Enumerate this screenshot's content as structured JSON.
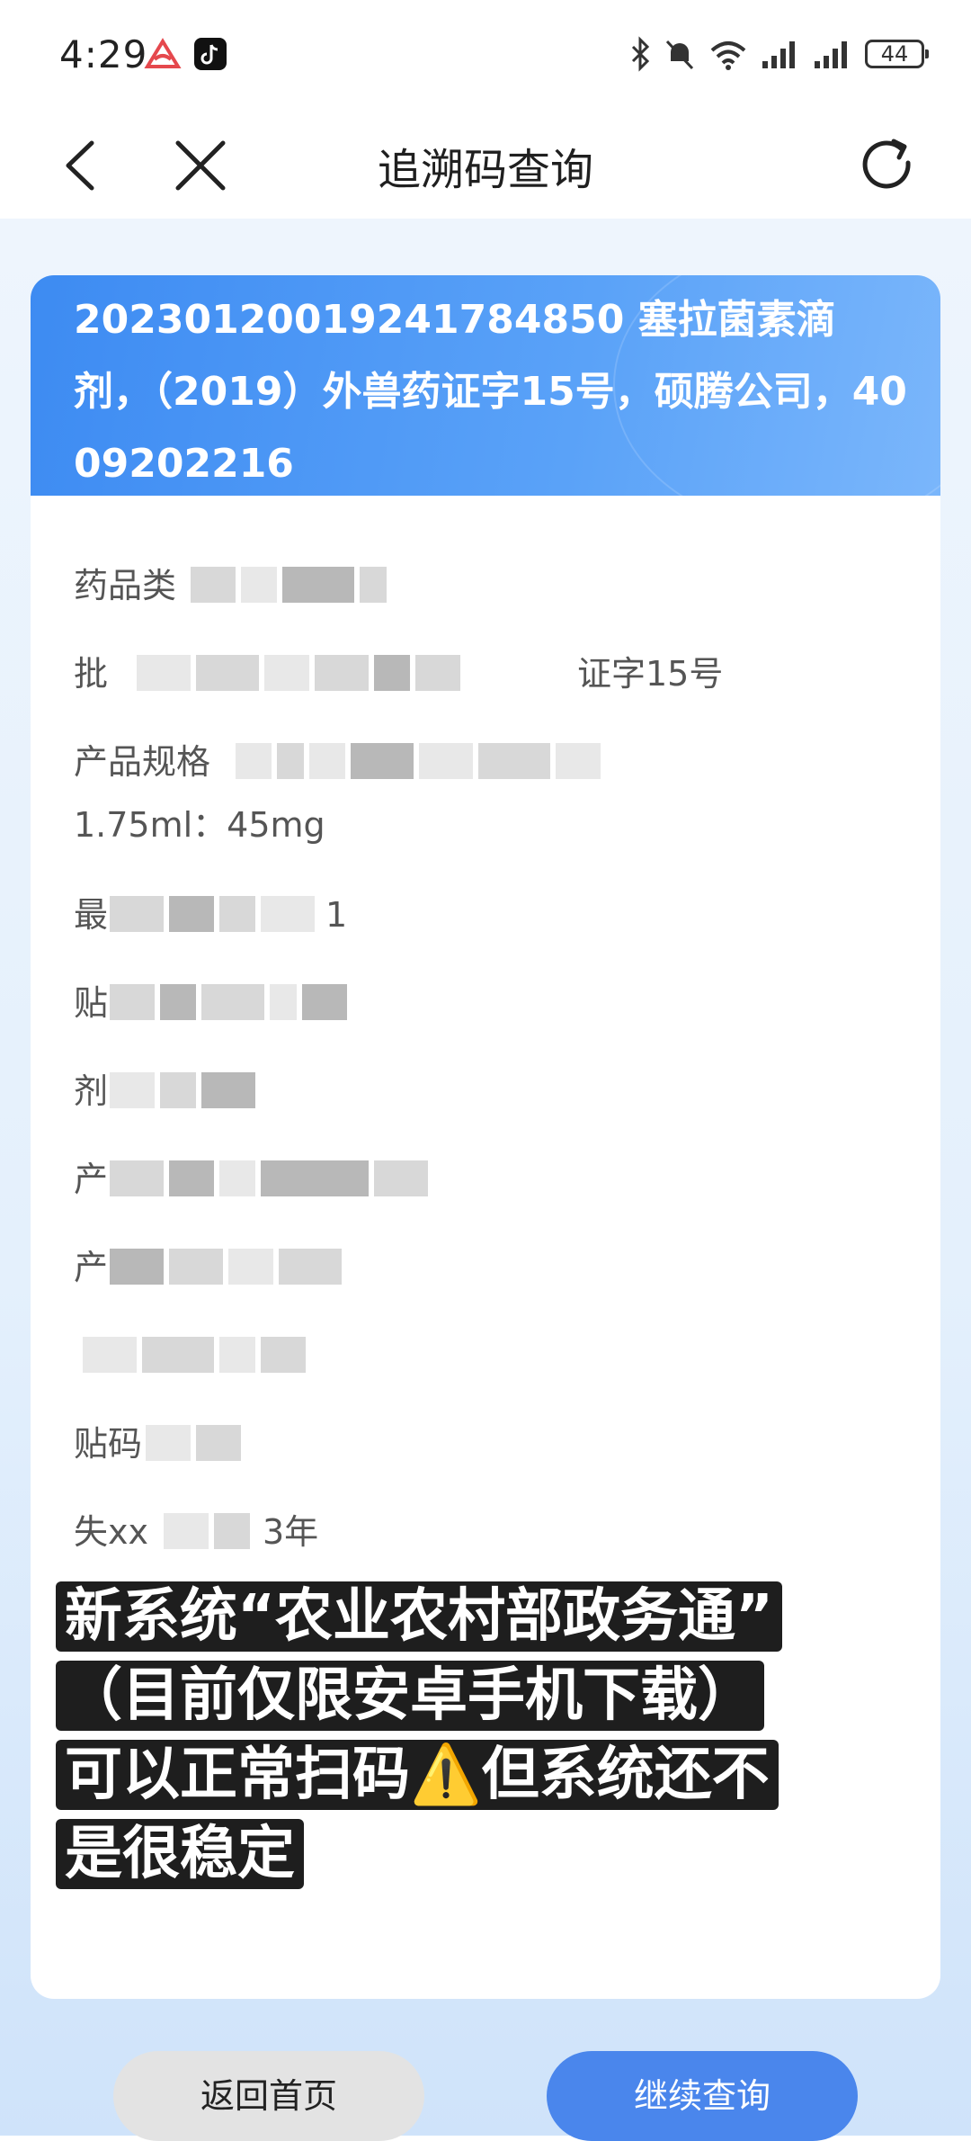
{
  "status_bar": {
    "time": "4:29",
    "battery": "44",
    "icons": [
      "app-notification-icon",
      "tiktok-icon",
      "bluetooth-icon",
      "mute-icon",
      "wifi-icon",
      "signal-icon",
      "signal-icon",
      "battery-icon"
    ]
  },
  "nav": {
    "title": "追溯码查询",
    "icons": [
      "back-icon",
      "close-icon",
      "refresh-icon"
    ]
  },
  "card": {
    "header_text": "20230120019241784850   塞拉菌素滴剂，（2019）外兽药证字15号，硕腾公司，4009202216",
    "fields": [
      {
        "label": "药品类",
        "value": ""
      },
      {
        "label": "批",
        "value": "证字15号"
      },
      {
        "label": "产品规格",
        "value": "1.75ml：45mg"
      },
      {
        "label": "最",
        "value": "1"
      },
      {
        "label": "贴",
        "value": ""
      },
      {
        "label": "剂",
        "value": ""
      },
      {
        "label": "产",
        "value": ""
      },
      {
        "label": "产",
        "value": ""
      },
      {
        "label": "",
        "value": ""
      },
      {
        "label": "贴码",
        "value": ""
      },
      {
        "label": "失xx",
        "value": "3年"
      }
    ]
  },
  "caption": {
    "line1": "新系统“农业农村部政务通”",
    "line2": "（目前仅限安卓手机下载）",
    "line3": "可以正常扫码⚠️但系统还不",
    "line4": "是很稳定"
  },
  "buttons": {
    "home": "返回首页",
    "continue": "继续查询"
  },
  "colors": {
    "header_blue": "#3d8bf2",
    "continue_button": "#4a86ec",
    "home_button": "#e3e3e3"
  }
}
